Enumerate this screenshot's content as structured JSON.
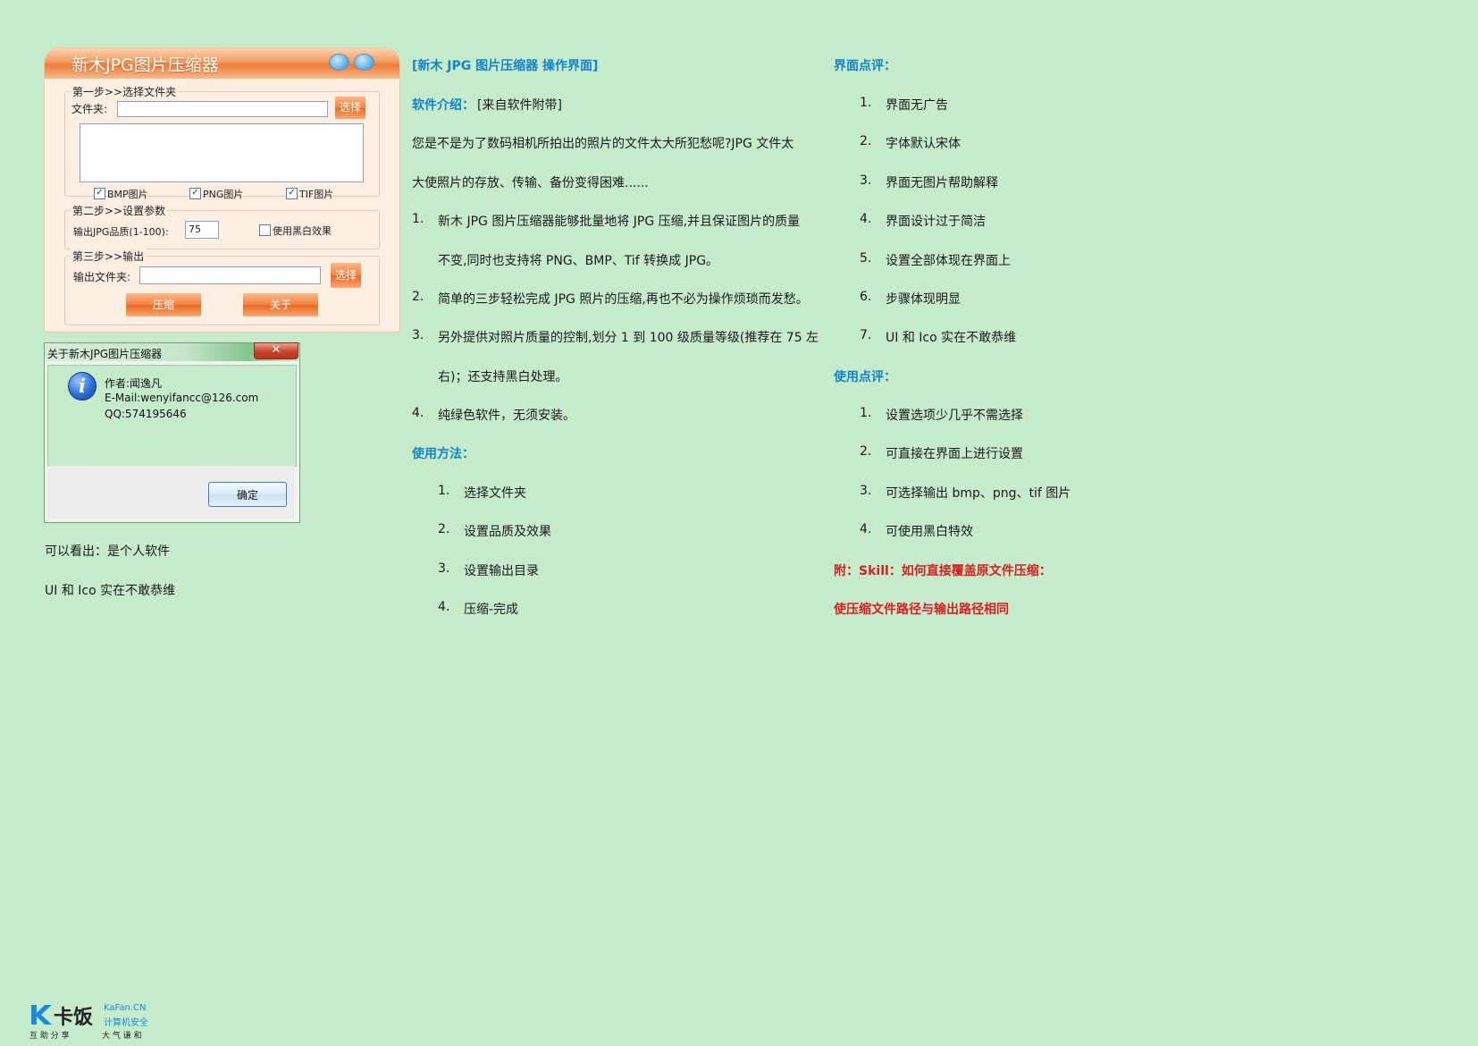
{
  "app": {
    "title": "新木JPG图片压缩器",
    "step1": {
      "legend": "第一步>>选择文件夹",
      "folder_label": "文件夹:",
      "folder_value": "",
      "select_button": "选择",
      "checkboxes": [
        {
          "label": "BMP图片",
          "checked": true
        },
        {
          "label": "PNG图片",
          "checked": true
        },
        {
          "label": "TIF图片",
          "checked": true
        }
      ]
    },
    "step2": {
      "legend": "第二步>>设置参数",
      "quality_label": "输出JPG品质(1-100):",
      "quality_value": "75",
      "bw_label": "使用黑白效果",
      "bw_checked": false
    },
    "step3": {
      "legend": "第三步>>输出",
      "output_label": "输出文件夹:",
      "output_value": "",
      "select_button": "选择"
    },
    "compress_button": "压缩",
    "about_button": "关于"
  },
  "about_dialog": {
    "title": "关于新木JPG图片压缩器",
    "close_glyph": "✕",
    "author": "作者:闻逸凡",
    "email": "E-Mail:wenyifancc@126.com",
    "qq": "QQ:574195646",
    "ok_button": "确定"
  },
  "left_notes": [
    "可以看出：是个人软件",
    "UI 和 Ico 实在不敢恭维"
  ],
  "middle": {
    "heading": "[新木 JPG 图片压缩器  操作界面]",
    "intro_label": "软件介绍：",
    "intro_value": "[来自软件附带]",
    "intro_text_1": "您是不是为了数码相机所拍出的照片的文件太大所犯愁呢?JPG 文件太",
    "intro_text_2": "大使照片的存放、传输、备份变得困难......",
    "features": [
      {
        "num": "1.",
        "lines": [
          "新木 JPG 图片压缩器能够批量地将 JPG 压缩,并且保证图片的质量",
          "不变,同时也支持将 PNG、BMP、Tif 转换成 JPG。"
        ]
      },
      {
        "num": "2.",
        "lines": [
          "简单的三步轻松完成 JPG 照片的压缩,再也不必为操作烦琐而发愁。"
        ]
      },
      {
        "num": "3.",
        "lines": [
          "另外提供对照片质量的控制,划分 1 到 100 级质量等级(推荐在 75 左",
          "右)；还支持黑白处理。"
        ]
      },
      {
        "num": "4.",
        "lines": [
          "纯绿色软件，无须安装。"
        ]
      }
    ],
    "usage_heading": "使用方法：",
    "usage_steps": [
      {
        "num": "1.",
        "text": "选择文件夹"
      },
      {
        "num": "2.",
        "text": "设置品质及效果"
      },
      {
        "num": "3.",
        "text": "设置输出目录"
      },
      {
        "num": "4.",
        "text": "压缩-完成"
      }
    ]
  },
  "right": {
    "ui_heading": "界面点评：",
    "ui_items": [
      {
        "num": "1.",
        "text": "界面无广告"
      },
      {
        "num": "2.",
        "text": "字体默认宋体"
      },
      {
        "num": "3.",
        "text": "界面无图片帮助解释"
      },
      {
        "num": "4.",
        "text": "界面设计过于简洁"
      },
      {
        "num": "5.",
        "text": "设置全部体现在界面上"
      },
      {
        "num": "6.",
        "text": "步骤体现明显"
      },
      {
        "num": "7.",
        "text": "UI 和 Ico 实在不敢恭维"
      }
    ],
    "use_heading": "使用点评：",
    "use_items": [
      {
        "num": "1.",
        "text": "设置选项少几乎不需选择"
      },
      {
        "num": "2.",
        "text": "可直接在界面上进行设置"
      },
      {
        "num": "3.",
        "text": "可选择输出 bmp、png、tif 图片"
      },
      {
        "num": "4.",
        "text": "可使用黑白特效"
      }
    ],
    "skill_heading": "附：Skill：如何直接覆盖原文件压缩：",
    "skill_text": "使压缩文件路径与输出路径相同"
  },
  "logo": {
    "name": "卡饭",
    "domain": "KaFan.CN",
    "subtitle": "计算机安全",
    "slogan_left": "互 助 分 享",
    "slogan_right": "大 气 谦 和"
  },
  "colors": {
    "background": "#c6ebcb",
    "heading_blue": "#1384c8",
    "heading_red": "#d42020",
    "app_orange": "#ee7c39"
  }
}
